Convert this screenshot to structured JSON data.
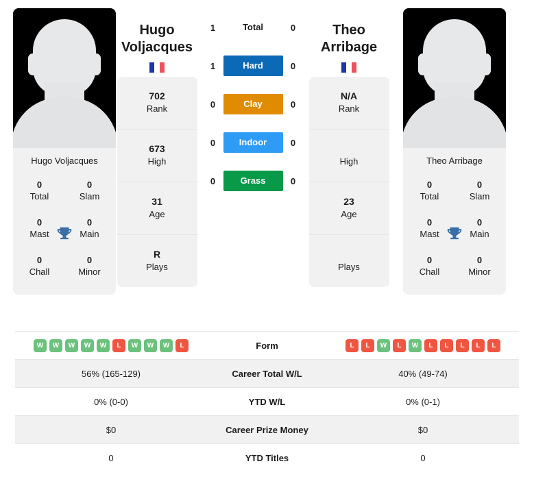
{
  "players": {
    "left": {
      "name_line1": "Hugo",
      "name_line2": "Voljacques",
      "full_name": "Hugo Voljacques",
      "flag": "FR",
      "avatar": "player-silhouette",
      "stats": [
        {
          "value": "702",
          "label": "Rank"
        },
        {
          "value": "673",
          "label": "High"
        },
        {
          "value": "31",
          "label": "Age"
        },
        {
          "value": "R",
          "label": "Plays"
        }
      ],
      "titles": [
        {
          "value": "0",
          "label": "Total"
        },
        {
          "value": "0",
          "label": "Slam"
        },
        {
          "value": "0",
          "label": "Mast"
        },
        {
          "value": "0",
          "label": "Main"
        },
        {
          "value": "0",
          "label": "Chall"
        },
        {
          "value": "0",
          "label": "Minor"
        }
      ],
      "form": [
        "W",
        "W",
        "W",
        "W",
        "W",
        "L",
        "W",
        "W",
        "W",
        "L"
      ],
      "career_total_wl": "56% (165-129)",
      "ytd_wl": "0% (0-0)",
      "career_prize_money": "$0",
      "ytd_titles": "0"
    },
    "right": {
      "name_line1": "Theo",
      "name_line2": "Arribage",
      "full_name": "Theo Arribage",
      "flag": "FR",
      "avatar": "player-silhouette",
      "stats": [
        {
          "value": "N/A",
          "label": "Rank"
        },
        {
          "value": "",
          "label": "High"
        },
        {
          "value": "23",
          "label": "Age"
        },
        {
          "value": "",
          "label": "Plays"
        }
      ],
      "titles": [
        {
          "value": "0",
          "label": "Total"
        },
        {
          "value": "0",
          "label": "Slam"
        },
        {
          "value": "0",
          "label": "Mast"
        },
        {
          "value": "0",
          "label": "Main"
        },
        {
          "value": "0",
          "label": "Chall"
        },
        {
          "value": "0",
          "label": "Minor"
        }
      ],
      "form": [
        "L",
        "L",
        "W",
        "L",
        "W",
        "L",
        "L",
        "L",
        "L",
        "L"
      ],
      "career_total_wl": "40% (49-74)",
      "ytd_wl": "0% (0-1)",
      "career_prize_money": "$0",
      "ytd_titles": "0"
    }
  },
  "head_to_head": {
    "rows": [
      {
        "label": "Total",
        "left": "1",
        "right": "0",
        "color": "",
        "plain": true
      },
      {
        "label": "Hard",
        "left": "1",
        "right": "0",
        "color": "#0b69b5",
        "plain": false
      },
      {
        "label": "Clay",
        "left": "0",
        "right": "0",
        "color": "#e08c00",
        "plain": false
      },
      {
        "label": "Indoor",
        "left": "0",
        "right": "0",
        "color": "#2e9bf5",
        "plain": false
      },
      {
        "label": "Grass",
        "left": "0",
        "right": "0",
        "color": "#089949",
        "plain": false
      }
    ]
  },
  "comparison_table": {
    "rows": [
      {
        "label": "Form",
        "left": "",
        "right": "",
        "type": "form"
      },
      {
        "label": "Career Total W/L",
        "left": "56% (165-129)",
        "right": "40% (49-74)",
        "type": "text"
      },
      {
        "label": "YTD W/L",
        "left": "0% (0-0)",
        "right": "0% (0-1)",
        "type": "text"
      },
      {
        "label": "Career Prize Money",
        "left": "$0",
        "right": "$0",
        "type": "text"
      },
      {
        "label": "YTD Titles",
        "left": "0",
        "right": "0",
        "type": "text"
      }
    ]
  },
  "colors": {
    "hard": "#0b69b5",
    "clay": "#e08c00",
    "indoor": "#2e9bf5",
    "grass": "#089949",
    "win": "#6cc17d",
    "loss": "#ef5540",
    "trophy": "#3a6ea5",
    "card_bg": "#f1f1f1"
  },
  "icons": {
    "trophy": "trophy-icon",
    "flag_fr": "flag-france-icon",
    "avatar": "avatar-silhouette-icon"
  }
}
